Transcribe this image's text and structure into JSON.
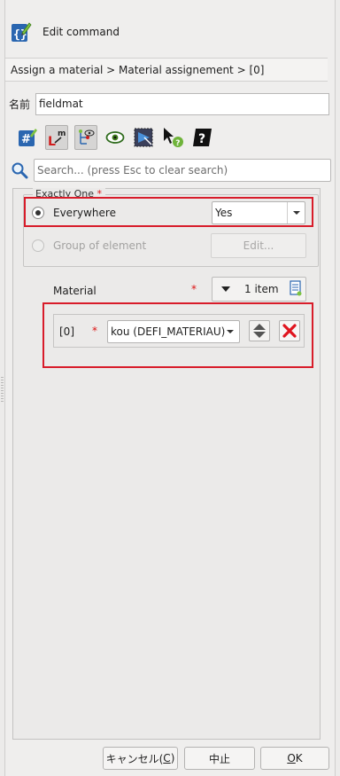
{
  "header": {
    "title": "Edit command",
    "icon": "edit-command-icon"
  },
  "breadcrumb": "Assign a material > Material assignement > [0]",
  "name_field": {
    "label": "名前",
    "value": "fieldmat"
  },
  "toolbar": {
    "buttons": [
      {
        "name": "hash-comment-icon",
        "active": false
      },
      {
        "name": "show-main-keywords-icon",
        "active": true
      },
      {
        "name": "show-parents-icon",
        "active": true
      },
      {
        "name": "eye-view-icon",
        "active": false
      },
      {
        "name": "show-selection-icon",
        "active": false
      },
      {
        "name": "whats-this-cursor-icon",
        "active": false
      },
      {
        "name": "help-book-icon",
        "active": false
      }
    ]
  },
  "search": {
    "placeholder": "Search... (press Esc to clear search)",
    "icon": "magnifier-icon"
  },
  "group": {
    "legend": "Exactly One",
    "required_mark": "*",
    "options": [
      {
        "label": "Everywhere",
        "checked": true,
        "enabled": true
      },
      {
        "label": "Group of element",
        "checked": false,
        "enabled": false
      }
    ],
    "everywhere_value": "Yes",
    "edit_button": "Edit..."
  },
  "material": {
    "label": "Material",
    "required_mark": "*",
    "count_label": "1 item",
    "items": [
      {
        "index": "[0]",
        "required_mark": "*",
        "value": "kou (DEFI_MATERIAU)"
      }
    ]
  },
  "footer": {
    "cancel_prefix": "キャンセル(",
    "cancel_key": "C",
    "cancel_suffix": ")",
    "abort": "中止",
    "ok_key": "O",
    "ok_rest": "K"
  },
  "colors": {
    "highlight": "#d81c2a",
    "delete_x": "#e0141e",
    "accent_blue": "#1f5fa8"
  }
}
